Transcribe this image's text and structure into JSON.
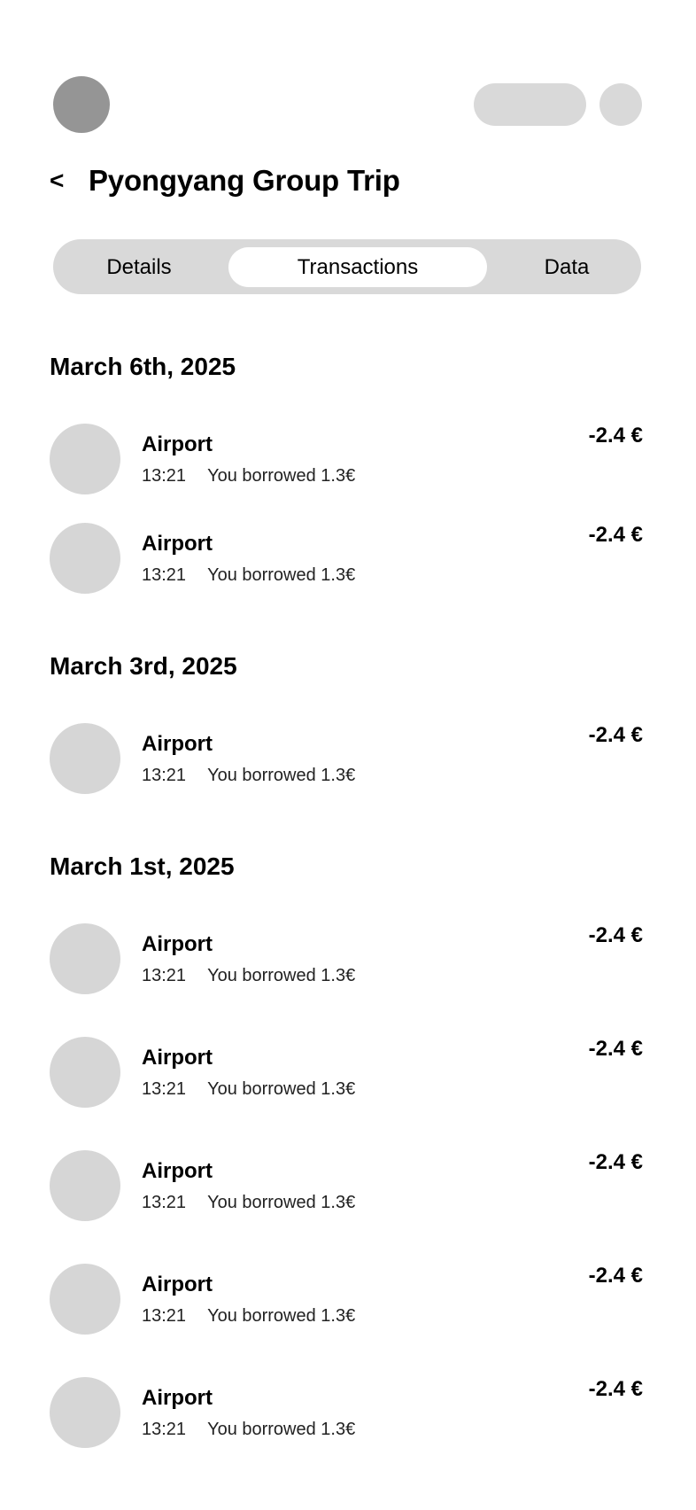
{
  "header": {
    "back_label": "<",
    "title": "Pyongyang Group Trip"
  },
  "tabs": [
    {
      "label": "Details",
      "active": false
    },
    {
      "label": "Transactions",
      "active": true
    },
    {
      "label": "Data",
      "active": false
    }
  ],
  "sections": [
    {
      "date": "March 6th, 2025",
      "transactions": [
        {
          "name": "Airport",
          "time": "13:21",
          "note": "You borrowed 1.3€",
          "amount": "-2.4 €"
        },
        {
          "name": "Airport",
          "time": "13:21",
          "note": "You borrowed 1.3€",
          "amount": "-2.4 €"
        }
      ]
    },
    {
      "date": "March 3rd, 2025",
      "transactions": [
        {
          "name": "Airport",
          "time": "13:21",
          "note": "You borrowed 1.3€",
          "amount": "-2.4 €"
        }
      ]
    },
    {
      "date": "March 1st, 2025",
      "transactions": [
        {
          "name": "Airport",
          "time": "13:21",
          "note": "You borrowed 1.3€",
          "amount": "-2.4 €"
        },
        {
          "name": "Airport",
          "time": "13:21",
          "note": "You borrowed 1.3€",
          "amount": "-2.4 €"
        },
        {
          "name": "Airport",
          "time": "13:21",
          "note": "You borrowed 1.3€",
          "amount": "-2.4 €"
        },
        {
          "name": "Airport",
          "time": "13:21",
          "note": "You borrowed 1.3€",
          "amount": "-2.4 €"
        },
        {
          "name": "Airport",
          "time": "13:21",
          "note": "You borrowed 1.3€",
          "amount": "-2.4 €"
        }
      ]
    }
  ]
}
